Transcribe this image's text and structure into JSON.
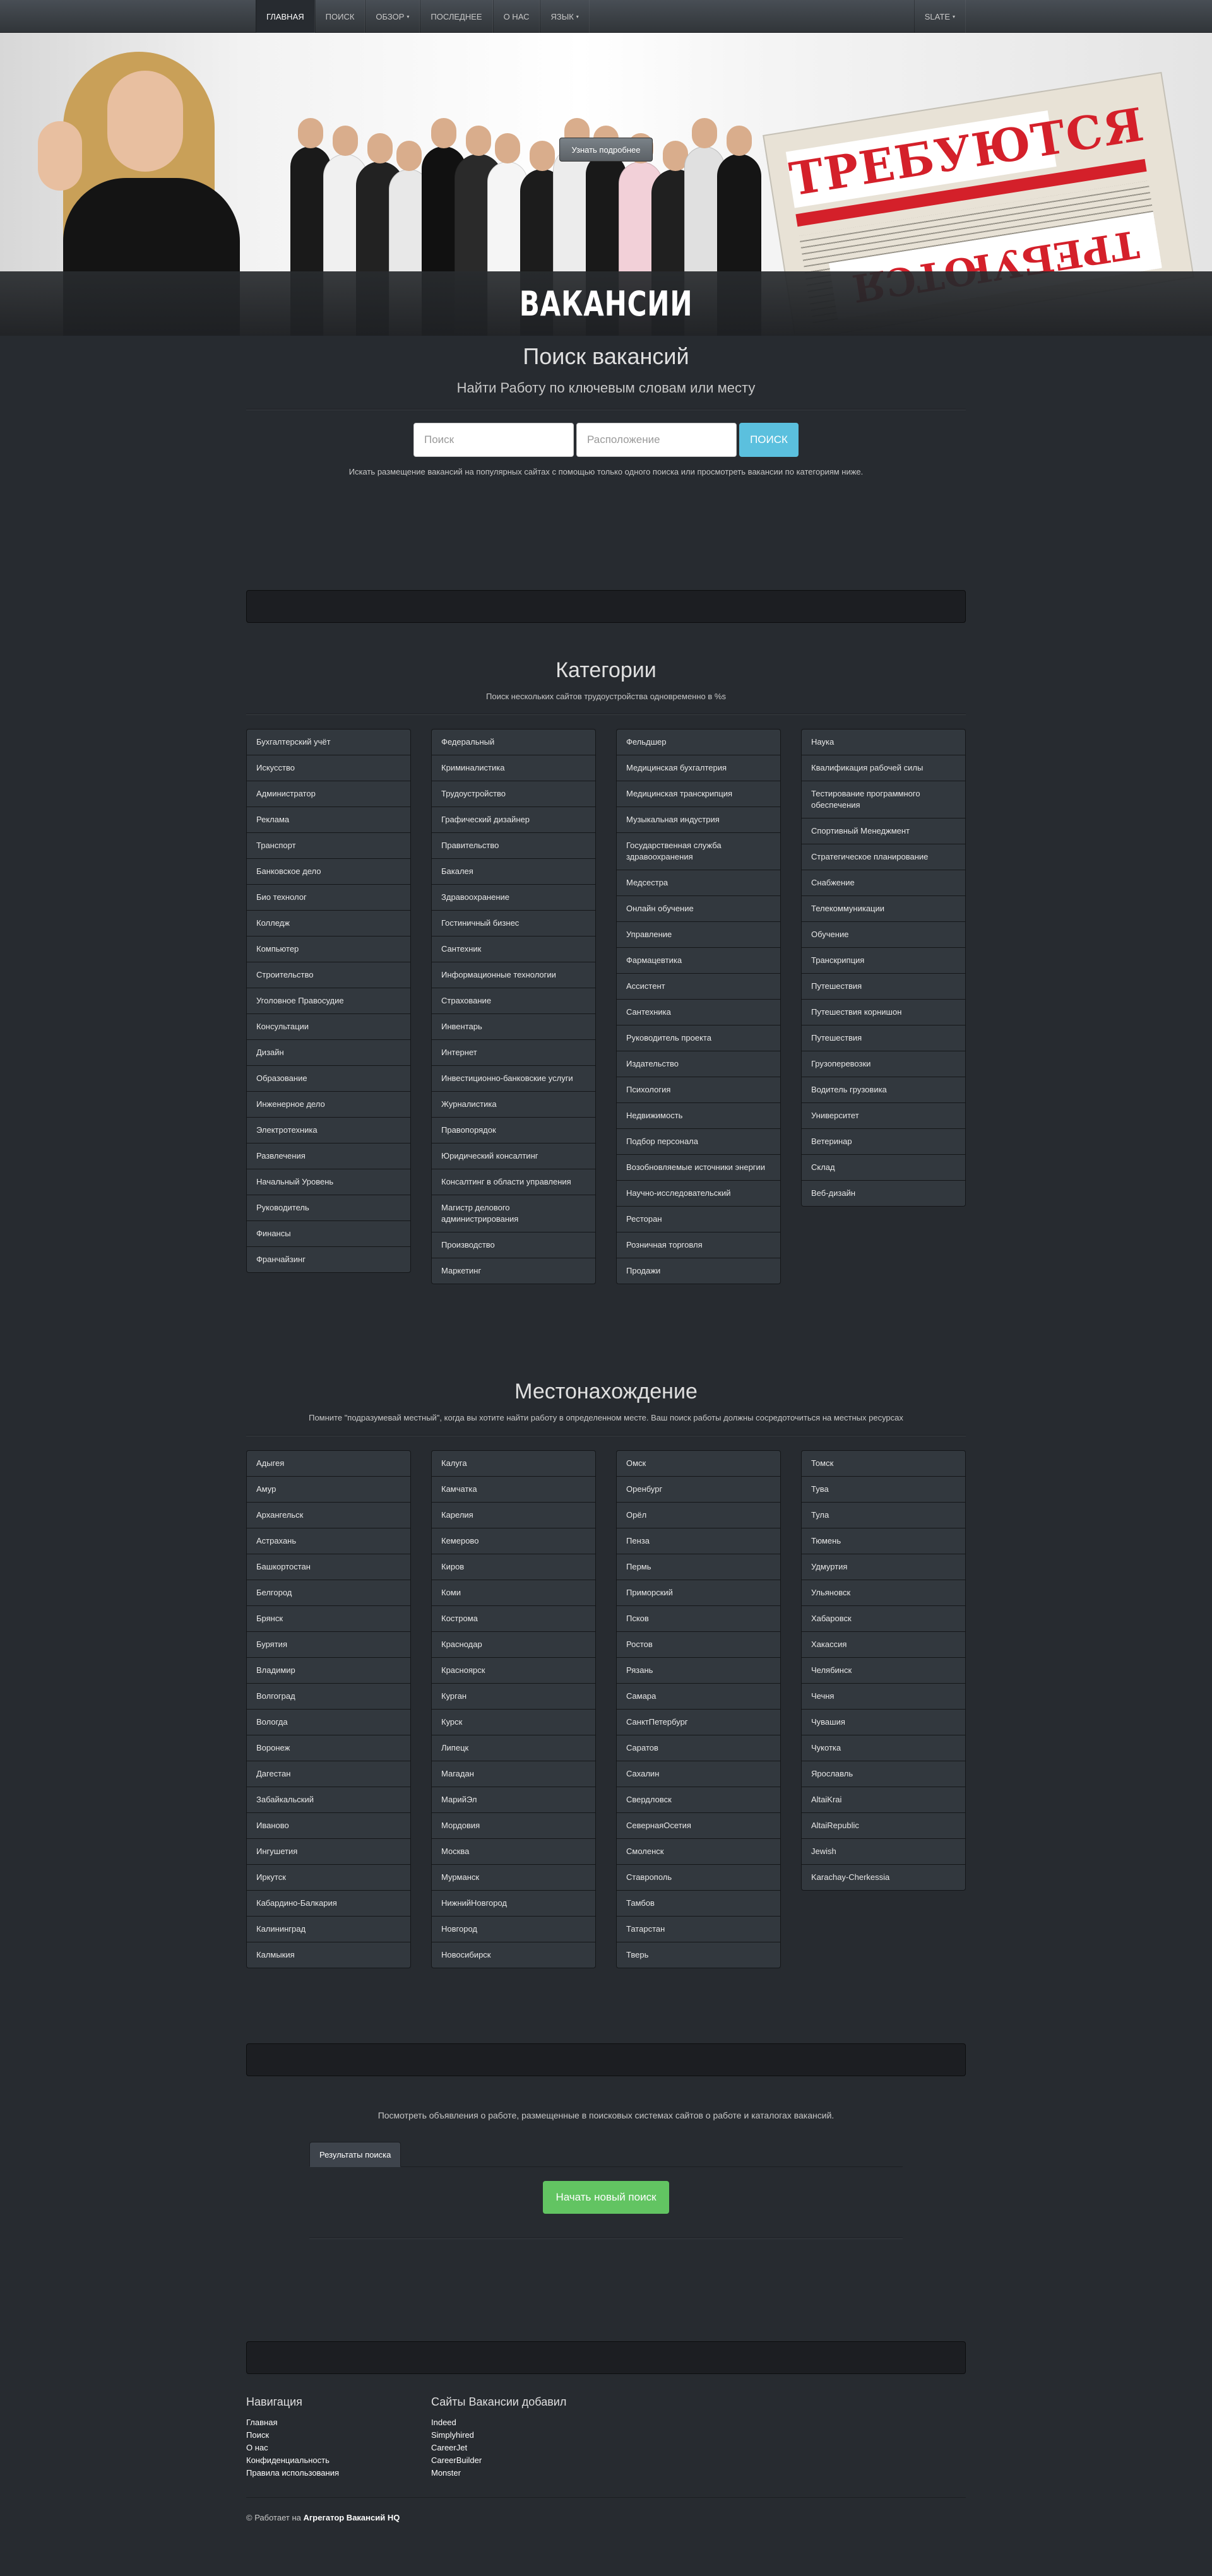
{
  "nav": {
    "items": [
      {
        "label": "ГЛАВНАЯ",
        "active": true,
        "dropdown": false
      },
      {
        "label": "ПОИСК",
        "active": false,
        "dropdown": false
      },
      {
        "label": "ОБЗОР",
        "active": false,
        "dropdown": true
      },
      {
        "label": "ПОСЛЕДНЕЕ",
        "active": false,
        "dropdown": false
      },
      {
        "label": "О НАС",
        "active": false,
        "dropdown": false
      },
      {
        "label": "ЯЗЫК",
        "active": false,
        "dropdown": true
      }
    ],
    "theme_label": "SLATE",
    "caret": "▾"
  },
  "hero": {
    "button_label": "Узнать подробнее",
    "title": "ВАКАНСИИ",
    "newspaper_headline": "ТРЕБУЮТСЯ",
    "colors": {
      "band": "#2b2e31",
      "headline": "#d4202a"
    }
  },
  "search": {
    "title": "Поиск вакансий",
    "subtitle": "Найти Работу по ключевым словам или месту",
    "keyword_placeholder": "Поиск",
    "location_placeholder": "Расположение",
    "button_label": "ПОИСК",
    "note": "Искать размещение вакансий на популярных сайтах с помощью только одного поиска или просмотреть вакансии по категориям ниже."
  },
  "categories": {
    "title": "Категории",
    "subtitle": "Поиск нескольких сайтов трудоустройства одновременно в %s",
    "columns": [
      [
        "Бухгалтерский учёт",
        "Искусство",
        "Администратор",
        "Реклама",
        "Транспорт",
        "Банковское дело",
        "Био технолог",
        "Колледж",
        "Компьютер",
        "Строительство",
        "Уголовное Правосудие",
        "Консультации",
        "Дизайн",
        "Образование",
        "Инженерное дело",
        "Электротехника",
        "Развлечения",
        "Начальный Уровень",
        "Руководитель",
        "Финансы",
        "Франчайзинг"
      ],
      [
        "Федеральный",
        "Криминалистика",
        "Трудоустройство",
        "Графический дизайнер",
        "Правительство",
        "Бакалея",
        "Здравоохранение",
        "Гостиничный бизнес",
        "Сантехник",
        "Информационные технологии",
        "Страхование",
        "Инвентарь",
        "Интернет",
        "Инвестиционно-банковские услуги",
        "Журналистика",
        "Правопорядок",
        "Юридический консалтинг",
        "Консалтинг в области управления",
        "Магистр делового администрирования",
        "Производство",
        "Маркетинг"
      ],
      [
        "Фельдшер",
        "Медицинская бухгалтерия",
        "Медицинская транскрипция",
        "Музыкальная индустрия",
        "Государственная служба здравоохранения",
        "Медсестра",
        "Онлайн обучение",
        "Управление",
        "Фармацевтика",
        "Ассистент",
        "Сантехника",
        "Руководитель проекта",
        "Издательство",
        "Психология",
        "Недвижимость",
        "Подбор персонала",
        "Возобновляемые источники энергии",
        "Научно-исследовательский",
        "Ресторан",
        "Розничная торговля",
        "Продажи"
      ],
      [
        "Наука",
        "Квалификация рабочей силы",
        "Тестирование программного обеспечения",
        "Спортивный Менеджмент",
        "Стратегическое планирование",
        "Снабжение",
        "Телекоммуникации",
        "Обучение",
        "Транскрипция",
        "Путешествия",
        "Путешествия корнишон",
        "Путешествия",
        "Грузоперевозки",
        "Водитель грузовика",
        "Университет",
        "Ветеринар",
        "Склад",
        "Веб-дизайн"
      ]
    ]
  },
  "locations": {
    "title": "Местонахождение",
    "subtitle": "Помните \"подразумевай местный\", когда вы хотите найти работу в определенном месте. Ваш поиск работы должны сосредоточиться на местных ресурсах",
    "columns": [
      [
        "Адыгея",
        "Амур",
        "Архангельск",
        "Астрахань",
        "Башкортостан",
        "Белгород",
        "Брянск",
        "Бурятия",
        "Владимир",
        "Волгоград",
        "Вологда",
        "Воронеж",
        "Дагестан",
        "Забайкальский",
        "Иваново",
        "Ингушетия",
        "Иркутск",
        "Кабардино-Балкария",
        "Калининград",
        "Калмыкия"
      ],
      [
        "Калуга",
        "Камчатка",
        "Карелия",
        "Кемерово",
        "Киров",
        "Коми",
        "Кострома",
        "Краснодар",
        "Красноярск",
        "Курган",
        "Курск",
        "Липецк",
        "Магадан",
        "МарийЭл",
        "Мордовия",
        "Москва",
        "Мурманск",
        "НижнийНовгород",
        "Новгород",
        "Новосибирск"
      ],
      [
        "Омск",
        "Оренбург",
        "Орёл",
        "Пенза",
        "Пермь",
        "Приморский",
        "Псков",
        "Ростов",
        "Рязань",
        "Самара",
        "СанктПетербург",
        "Саратов",
        "Сахалин",
        "Свердловск",
        "СевернаяОсетия",
        "Смоленск",
        "Ставрополь",
        "Тамбов",
        "Татарстан",
        "Тверь"
      ],
      [
        "Томск",
        "Тува",
        "Тула",
        "Тюмень",
        "Удмуртия",
        "Ульяновск",
        "Хабаровск",
        "Хакассия",
        "Челябинск",
        "Чечня",
        "Чувашия",
        "Чукотка",
        "Ярославль",
        "AltaiKrai",
        "AltaiRepublic",
        "Jewish",
        "Karachay-Cherkessia"
      ]
    ]
  },
  "results": {
    "note": "Посмотреть объявления о работе, размещенные в поисковых системах сайтов о работе и каталогах вакансий.",
    "tab_label": "Результаты поиска",
    "new_search_label": "Начать новый поиск"
  },
  "footer": {
    "nav_title": "Навигация",
    "nav_links": [
      "Главная",
      "Поиск",
      "О нас",
      "Конфиденциальность",
      "Правила использования"
    ],
    "sites_title": "Сайты Вакансии добавил",
    "sites_links": [
      "Indeed",
      "Simplyhired",
      "CareerJet",
      "CareerBuilder",
      "Monster"
    ],
    "powered_prefix": "© Работает на",
    "powered_link": "Агрегатор Вакансий HQ"
  }
}
